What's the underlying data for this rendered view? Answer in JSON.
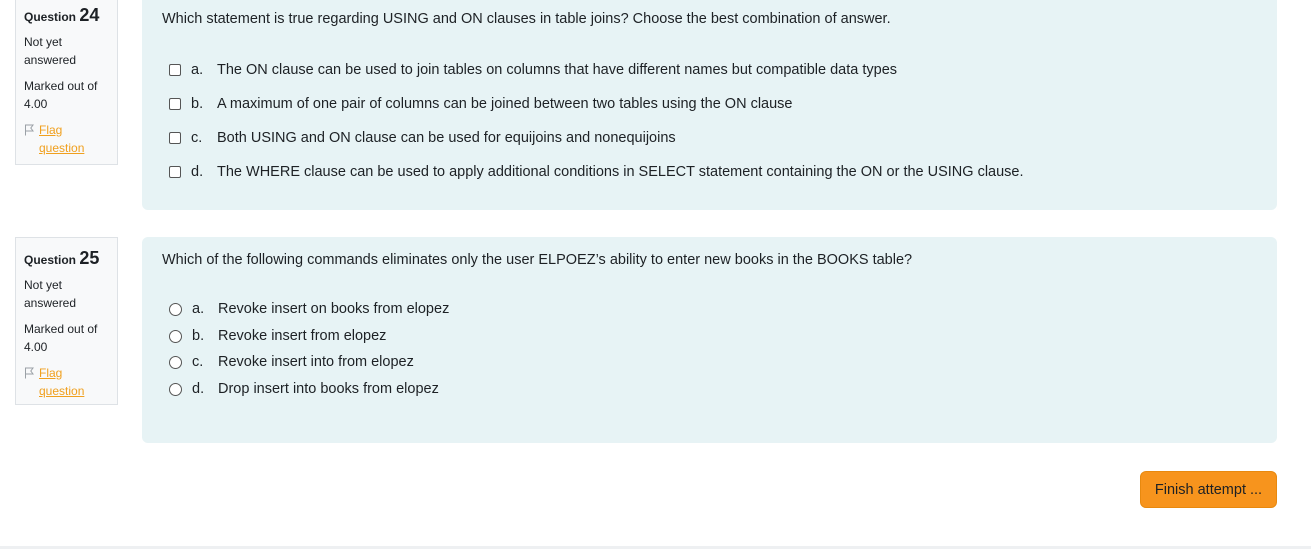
{
  "questions": [
    {
      "label": "Question",
      "number": "24",
      "state": "Not yet answered",
      "grade": "Marked out of 4.00",
      "flag_label": "Flag question",
      "text": "Which statement is true regarding USING and ON clauses in table joins? Choose the best combination of answer.",
      "input_type": "checkbox",
      "answers": [
        {
          "letter": "a.",
          "text": "The ON clause can be used to join tables on columns that have different names but compatible data types"
        },
        {
          "letter": "b.",
          "text": "A maximum of one pair of columns can be joined between two tables using the ON clause"
        },
        {
          "letter": "c.",
          "text": "Both USING and ON clause can be used for equijoins and nonequijoins"
        },
        {
          "letter": "d.",
          "text": "The WHERE clause can be used to apply additional conditions in SELECT statement containing the ON or the USING clause."
        }
      ]
    },
    {
      "label": "Question",
      "number": "25",
      "state": "Not yet answered",
      "grade": "Marked out of 4.00",
      "flag_label": "Flag question",
      "text": "Which of the following commands eliminates only the user ELPOEZ’s ability to enter new books in the BOOKS table?",
      "input_type": "radio",
      "answers": [
        {
          "letter": "a.",
          "text": "Revoke insert on books from elopez"
        },
        {
          "letter": "b.",
          "text": "Revoke insert from elopez"
        },
        {
          "letter": "c.",
          "text": "Revoke insert into from elopez"
        },
        {
          "letter": "d.",
          "text": "Drop insert into books from elopez"
        }
      ]
    }
  ],
  "footer": {
    "finish_label": "Finish attempt ..."
  },
  "colors": {
    "accent": "#f7941d",
    "flag": "#f0a01e",
    "formulation_bg": "#e7f3f5"
  },
  "icons": {
    "flag": "flag-outline-icon"
  }
}
